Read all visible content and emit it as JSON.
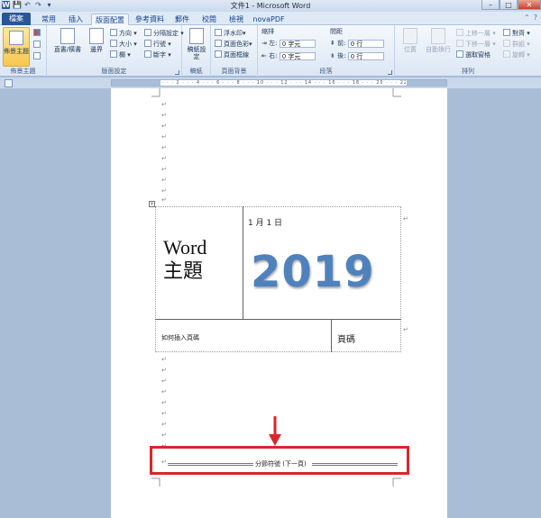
{
  "window": {
    "title": "文件1 - Microsoft Word",
    "controls": {
      "minimize": "–",
      "maximize": "□",
      "close": "✕"
    }
  },
  "qat": {
    "save": "💾",
    "undo": "↶",
    "redo": "↷",
    "more": "▾"
  },
  "tabs": {
    "file": "檔案",
    "items": [
      "常用",
      "插入",
      "版面配置",
      "參考資料",
      "郵件",
      "校閱",
      "檢視",
      "novaPDF"
    ],
    "active": "版面配置"
  },
  "ribbon": {
    "theme": {
      "button": "佈景主題",
      "group": "佈景主題"
    },
    "page_setup": {
      "text_direction": "直書/橫書",
      "margins": "邊界",
      "orientation": "方向",
      "size": "大小",
      "columns": "欄",
      "breaks": "分隔設定",
      "line_numbers": "行號",
      "hyphenation": "斷字",
      "group": "版面設定"
    },
    "draft": {
      "button": "稿紙設定",
      "group": "稿紙"
    },
    "page_background": {
      "watermark": "浮水印",
      "page_color": "頁面色彩",
      "page_borders": "頁面框線",
      "group": "頁面背景"
    },
    "paragraph": {
      "indent": "縮排",
      "spacing": "間距",
      "left_label": "左:",
      "right_label": "右:",
      "before_label": "前:",
      "after_label": "後:",
      "left": "0 字元",
      "right": "0 字元",
      "before": "0 行",
      "after": "0 行",
      "group": "段落"
    },
    "arrange": {
      "position": "位置",
      "wrap_text": "自動換行",
      "bring_forward": "上移一層",
      "send_backward": "下移一層",
      "selection_pane": "選取窗格",
      "align": "對齊",
      "group_btn": "群組",
      "rotate": "旋轉",
      "group": "排列"
    }
  },
  "document": {
    "cover": {
      "title": "Word\n主題",
      "date": "1 月 1 日",
      "year": "2019",
      "howto": "如何插入頁碼",
      "page_number": "頁碼"
    },
    "paragraph_mark": "↵",
    "section_break": "分節符號 (下一頁)"
  },
  "colors": {
    "annotation": "#d9262b",
    "year": "#4f81bd",
    "file_tab": "#2a5699"
  }
}
